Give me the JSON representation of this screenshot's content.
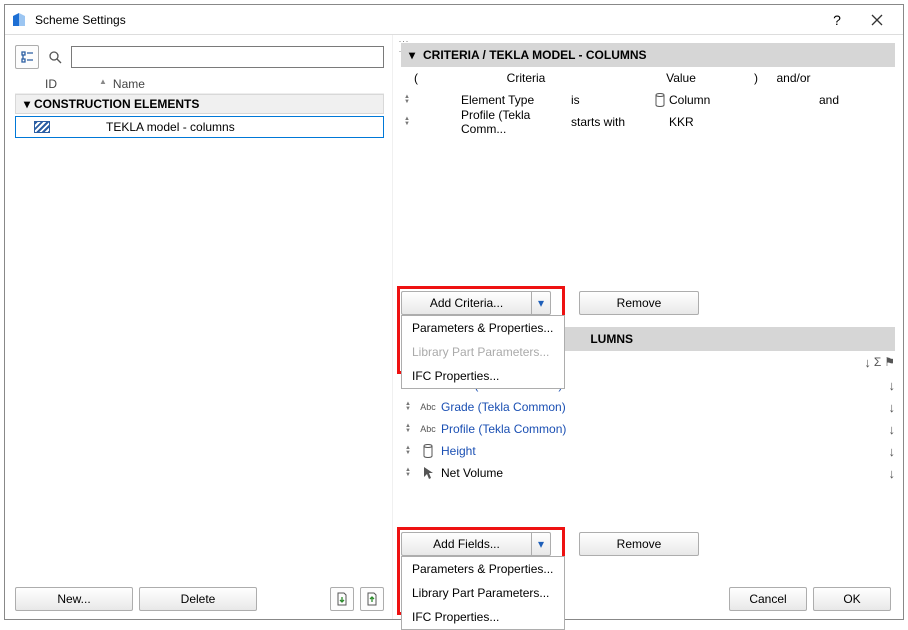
{
  "window": {
    "title": "Scheme Settings"
  },
  "left": {
    "search_placeholder": "",
    "headers": {
      "id": "ID",
      "name": "Name"
    },
    "group": "CONSTRUCTION ELEMENTS",
    "rows": [
      {
        "id": "",
        "name": "TEKLA model - columns"
      }
    ],
    "buttons": {
      "new": "New...",
      "delete": "Delete"
    }
  },
  "criteria": {
    "title": "CRITERIA /  TEKLA MODEL - COLUMNS",
    "headers": {
      "lparen": "(",
      "criteria": "Criteria",
      "value": "Value",
      "rparen": ")",
      "andor": "and/or"
    },
    "rows": [
      {
        "criteria": "Element Type",
        "op": "is",
        "value": "Column",
        "andor": "and",
        "icon": "column"
      },
      {
        "criteria": "Profile (Tekla Comm...",
        "op": "starts with",
        "value": "KKR",
        "andor": "",
        "icon": ""
      }
    ],
    "add_label": "Add Criteria...",
    "remove_label": "Remove",
    "menu": {
      "pp": "Parameters & Properties...",
      "lib": "Library Part Parameters...",
      "ifc": "IFC Properties..."
    }
  },
  "fields": {
    "title_suffix": "LUMNS",
    "rows": [
      {
        "type": "Abc",
        "name": "Class (Tekla Common)",
        "link": true
      },
      {
        "type": "Abc",
        "name": "Grade (Tekla Common)",
        "link": true
      },
      {
        "type": "Abc",
        "name": "Profile (Tekla Common)",
        "link": true
      },
      {
        "type": "column-icon",
        "name": "Height",
        "link": true
      },
      {
        "type": "cursor-icon",
        "name": "Net Volume",
        "link": false
      }
    ],
    "add_label": "Add Fields...",
    "remove_label": "Remove",
    "menu": {
      "pp": "Parameters & Properties...",
      "lib": "Library Part Parameters...",
      "ifc": "IFC Properties..."
    }
  },
  "footer": {
    "cancel": "Cancel",
    "ok": "OK"
  }
}
